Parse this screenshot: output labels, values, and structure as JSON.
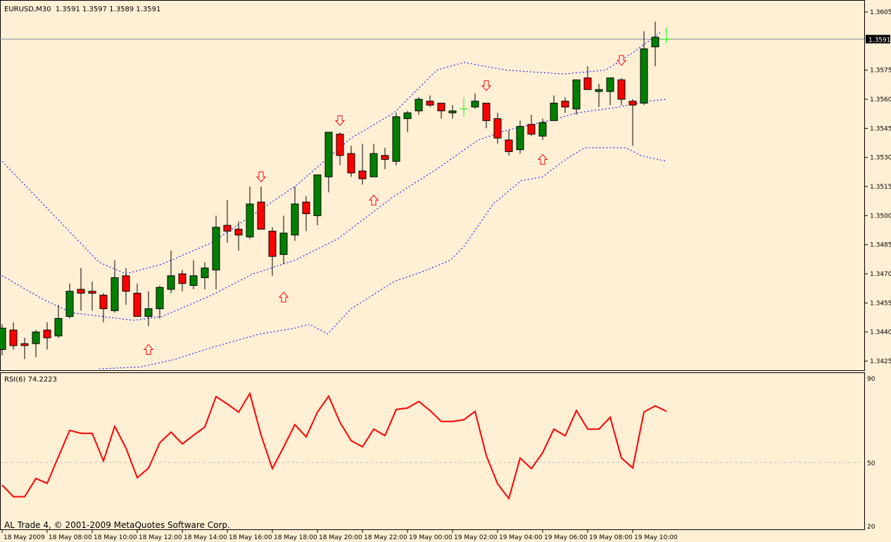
{
  "header": {
    "symbol": "EURUSD,M30",
    "ohlc": "1.3591 1.3597 1.3589 1.3591"
  },
  "footer": "AL Trade 4, © 2001-2009 MetaQuotes Software Corp.",
  "colors": {
    "background": "#ffefd5",
    "bull": "#008000",
    "bear": "#ff0000",
    "doji": "#00ff00",
    "bands": "#0000ff",
    "rsi": "#ff0000",
    "current_line": "#7b8da8"
  },
  "chart_data": {
    "type": "candlestick",
    "title": "EURUSD,M30",
    "ylim": [
      1.3418,
      1.3611
    ],
    "price_ticks": [
      "1.3605",
      "1.3575",
      "1.3560",
      "1.3545",
      "1.3530",
      "1.3515",
      "1.3500",
      "1.3485",
      "1.3470",
      "1.3455",
      "1.3440",
      "1.3425"
    ],
    "current_price": "1.3591",
    "time_labels": [
      {
        "index": 0,
        "label": "18 May 2009"
      },
      {
        "index": 4,
        "label": "18 May 08:00"
      },
      {
        "index": 8,
        "label": "18 May 10:00"
      },
      {
        "index": 12,
        "label": "18 May 12:00"
      },
      {
        "index": 16,
        "label": "18 May 14:00"
      },
      {
        "index": 20,
        "label": "18 May 16:00"
      },
      {
        "index": 24,
        "label": "18 May 18:00"
      },
      {
        "index": 28,
        "label": "18 May 20:00"
      },
      {
        "index": 32,
        "label": "18 May 22:00"
      },
      {
        "index": 36,
        "label": "19 May 00:00"
      },
      {
        "index": 40,
        "label": "19 May 02:00"
      },
      {
        "index": 44,
        "label": "19 May 04:00"
      },
      {
        "index": 48,
        "label": "19 May 06:00"
      },
      {
        "index": 52,
        "label": "19 May 08:00"
      },
      {
        "index": 56,
        "label": "19 May 10:00"
      }
    ],
    "candles_ohlc": [
      [
        1.3431,
        1.3444,
        1.3428,
        1.3442
      ],
      [
        1.3441,
        1.3445,
        1.3431,
        1.3433
      ],
      [
        1.3434,
        1.3437,
        1.3426,
        1.3433
      ],
      [
        1.3434,
        1.3441,
        1.3427,
        1.344
      ],
      [
        1.3441,
        1.3445,
        1.3431,
        1.3437
      ],
      [
        1.3438,
        1.3454,
        1.3437,
        1.3447
      ],
      [
        1.3448,
        1.3465,
        1.3447,
        1.3461
      ],
      [
        1.3462,
        1.3473,
        1.3451,
        1.346
      ],
      [
        1.3461,
        1.3466,
        1.3451,
        1.346
      ],
      [
        1.3459,
        1.346,
        1.3445,
        1.3452
      ],
      [
        1.3451,
        1.3477,
        1.345,
        1.3468
      ],
      [
        1.3469,
        1.3473,
        1.3454,
        1.3461
      ],
      [
        1.346,
        1.3465,
        1.3448,
        1.3448
      ],
      [
        1.3448,
        1.3461,
        1.3443,
        1.3452
      ],
      [
        1.3452,
        1.3464,
        1.3447,
        1.3463
      ],
      [
        1.3462,
        1.3482,
        1.346,
        1.3469
      ],
      [
        1.347,
        1.3472,
        1.3461,
        1.3465
      ],
      [
        1.3464,
        1.3477,
        1.3462,
        1.3469
      ],
      [
        1.3468,
        1.3476,
        1.3462,
        1.3473
      ],
      [
        1.3472,
        1.35,
        1.3462,
        1.3494
      ],
      [
        1.3495,
        1.3508,
        1.3486,
        1.3492
      ],
      [
        1.3493,
        1.3497,
        1.3482,
        1.349
      ],
      [
        1.3489,
        1.3515,
        1.3488,
        1.3506
      ],
      [
        1.3507,
        1.3515,
        1.3493,
        1.3493
      ],
      [
        1.3492,
        1.3494,
        1.3469,
        1.3479
      ],
      [
        1.348,
        1.35,
        1.3475,
        1.3491
      ],
      [
        1.349,
        1.3515,
        1.3487,
        1.3506
      ],
      [
        1.3507,
        1.351,
        1.3492,
        1.3501
      ],
      [
        1.35,
        1.3521,
        1.3495,
        1.3521
      ],
      [
        1.352,
        1.3543,
        1.3512,
        1.3543
      ],
      [
        1.3542,
        1.3543,
        1.3526,
        1.3531
      ],
      [
        1.3532,
        1.3536,
        1.352,
        1.3522
      ],
      [
        1.3523,
        1.3537,
        1.3516,
        1.3519
      ],
      [
        1.352,
        1.3537,
        1.352,
        1.3532
      ],
      [
        1.3531,
        1.3535,
        1.3524,
        1.3529
      ],
      [
        1.3528,
        1.3553,
        1.3526,
        1.3551
      ],
      [
        1.355,
        1.3554,
        1.3543,
        1.3553
      ],
      [
        1.3554,
        1.3561,
        1.3552,
        1.356
      ],
      [
        1.3559,
        1.3562,
        1.3556,
        1.3557
      ],
      [
        1.3558,
        1.3558,
        1.355,
        1.3554
      ],
      [
        1.3553,
        1.3557,
        1.355,
        1.3554
      ],
      [
        1.3555,
        1.3561,
        1.3551,
        1.3555
      ],
      [
        1.3556,
        1.3563,
        1.3555,
        1.3559
      ],
      [
        1.3558,
        1.3558,
        1.3545,
        1.3549
      ],
      [
        1.355,
        1.3553,
        1.3537,
        1.354
      ],
      [
        1.3539,
        1.3544,
        1.3531,
        1.3533
      ],
      [
        1.3534,
        1.3549,
        1.3532,
        1.3546
      ],
      [
        1.3547,
        1.3552,
        1.3541,
        1.3542
      ],
      [
        1.3541,
        1.355,
        1.3539,
        1.3548
      ],
      [
        1.3549,
        1.3562,
        1.3549,
        1.3558
      ],
      [
        1.3559,
        1.3561,
        1.3553,
        1.3556
      ],
      [
        1.3555,
        1.357,
        1.3552,
        1.357
      ],
      [
        1.3571,
        1.3577,
        1.3565,
        1.3565
      ],
      [
        1.3564,
        1.3568,
        1.3556,
        1.3565
      ],
      [
        1.3564,
        1.3571,
        1.3557,
        1.3571
      ],
      [
        1.357,
        1.3571,
        1.3557,
        1.356
      ],
      [
        1.3559,
        1.356,
        1.3536,
        1.3557
      ],
      [
        1.3558,
        1.3595,
        1.3557,
        1.3586
      ],
      [
        1.3587,
        1.36,
        1.3577,
        1.3592
      ],
      [
        1.3591,
        1.3597,
        1.3589,
        1.3591
      ]
    ],
    "bollinger": {
      "upper": [
        [
          0,
          1.3528
        ],
        [
          8.6,
          1.3476
        ],
        [
          11,
          1.347
        ],
        [
          14.2,
          1.3475
        ],
        [
          18.6,
          1.3486
        ],
        [
          26,
          1.3515
        ],
        [
          28.6,
          1.3528
        ],
        [
          31,
          1.354
        ],
        [
          34.8,
          1.3553
        ],
        [
          38.6,
          1.3575
        ],
        [
          41,
          1.3579
        ],
        [
          44.8,
          1.3575
        ],
        [
          49.8,
          1.3573
        ],
        [
          53.6,
          1.3575
        ],
        [
          56,
          1.3584
        ],
        [
          58.6,
          1.3595
        ]
      ],
      "middle": [
        [
          0,
          1.3469
        ],
        [
          3.6,
          1.3457
        ],
        [
          6.1,
          1.345
        ],
        [
          11.7,
          1.3446
        ],
        [
          14.2,
          1.3448
        ],
        [
          18.6,
          1.3459
        ],
        [
          22.3,
          1.347
        ],
        [
          26,
          1.3477
        ],
        [
          29.8,
          1.3488
        ],
        [
          32.3,
          1.3499
        ],
        [
          34.8,
          1.351
        ],
        [
          38.6,
          1.3524
        ],
        [
          42.3,
          1.3539
        ],
        [
          44.8,
          1.3544
        ],
        [
          48.6,
          1.3549
        ],
        [
          51.1,
          1.3553
        ],
        [
          54.8,
          1.3556
        ],
        [
          57.3,
          1.3559
        ],
        [
          59,
          1.356
        ]
      ],
      "lower": [
        [
          8.6,
          1.3421
        ],
        [
          12.3,
          1.3422
        ],
        [
          15.4,
          1.3426
        ],
        [
          18.6,
          1.3432
        ],
        [
          22.9,
          1.3439
        ],
        [
          26,
          1.3442
        ],
        [
          27.3,
          1.3444
        ],
        [
          28.9,
          1.3439
        ],
        [
          31,
          1.3452
        ],
        [
          34.8,
          1.3466
        ],
        [
          37.3,
          1.3471
        ],
        [
          39.8,
          1.3477
        ],
        [
          41,
          1.3484
        ],
        [
          43.6,
          1.3506
        ],
        [
          46.1,
          1.3518
        ],
        [
          48,
          1.352
        ],
        [
          49.8,
          1.3528
        ],
        [
          51.7,
          1.3535
        ],
        [
          55.4,
          1.3535
        ],
        [
          56.7,
          1.3531
        ],
        [
          59,
          1.3528
        ]
      ]
    },
    "signals": [
      {
        "type": "down",
        "index": 23,
        "price": 1.352
      },
      {
        "type": "down",
        "index": 30,
        "price": 1.3549
      },
      {
        "type": "down",
        "index": 43,
        "price": 1.3567
      },
      {
        "type": "down",
        "index": 55,
        "price": 1.358
      },
      {
        "type": "up",
        "index": 13,
        "price": 1.3431
      },
      {
        "type": "up",
        "index": 25,
        "price": 1.3458
      },
      {
        "type": "up",
        "index": 33,
        "price": 1.3508
      },
      {
        "type": "up",
        "index": 48,
        "price": 1.3529
      }
    ],
    "rsi": {
      "label": "RSI(6) 74.2223",
      "ylim": [
        20,
        90
      ],
      "ticks": [
        "90",
        "50",
        "20"
      ],
      "level": 50,
      "values": [
        39.3,
        33.8,
        33.8,
        42.4,
        40.1,
        52.7,
        65.2,
        63.8,
        63.8,
        50.7,
        67.1,
        56.8,
        42.8,
        47.3,
        59.3,
        64.4,
        58.8,
        62.9,
        66.8,
        81.2,
        77.7,
        73.8,
        82.7,
        62.9,
        47.1,
        57.3,
        67.9,
        62.1,
        73.8,
        81.4,
        69.0,
        60.3,
        57.4,
        65.8,
        62.7,
        75.1,
        75.8,
        78.9,
        74.6,
        69.4,
        69.4,
        70.2,
        74.2,
        53.2,
        39.9,
        32.9,
        52.1,
        47.1,
        54.6,
        65.8,
        62.6,
        74.6,
        65.8,
        65.8,
        71.4,
        52.1,
        47.4,
        73.9,
        76.8,
        74.2
      ]
    }
  }
}
